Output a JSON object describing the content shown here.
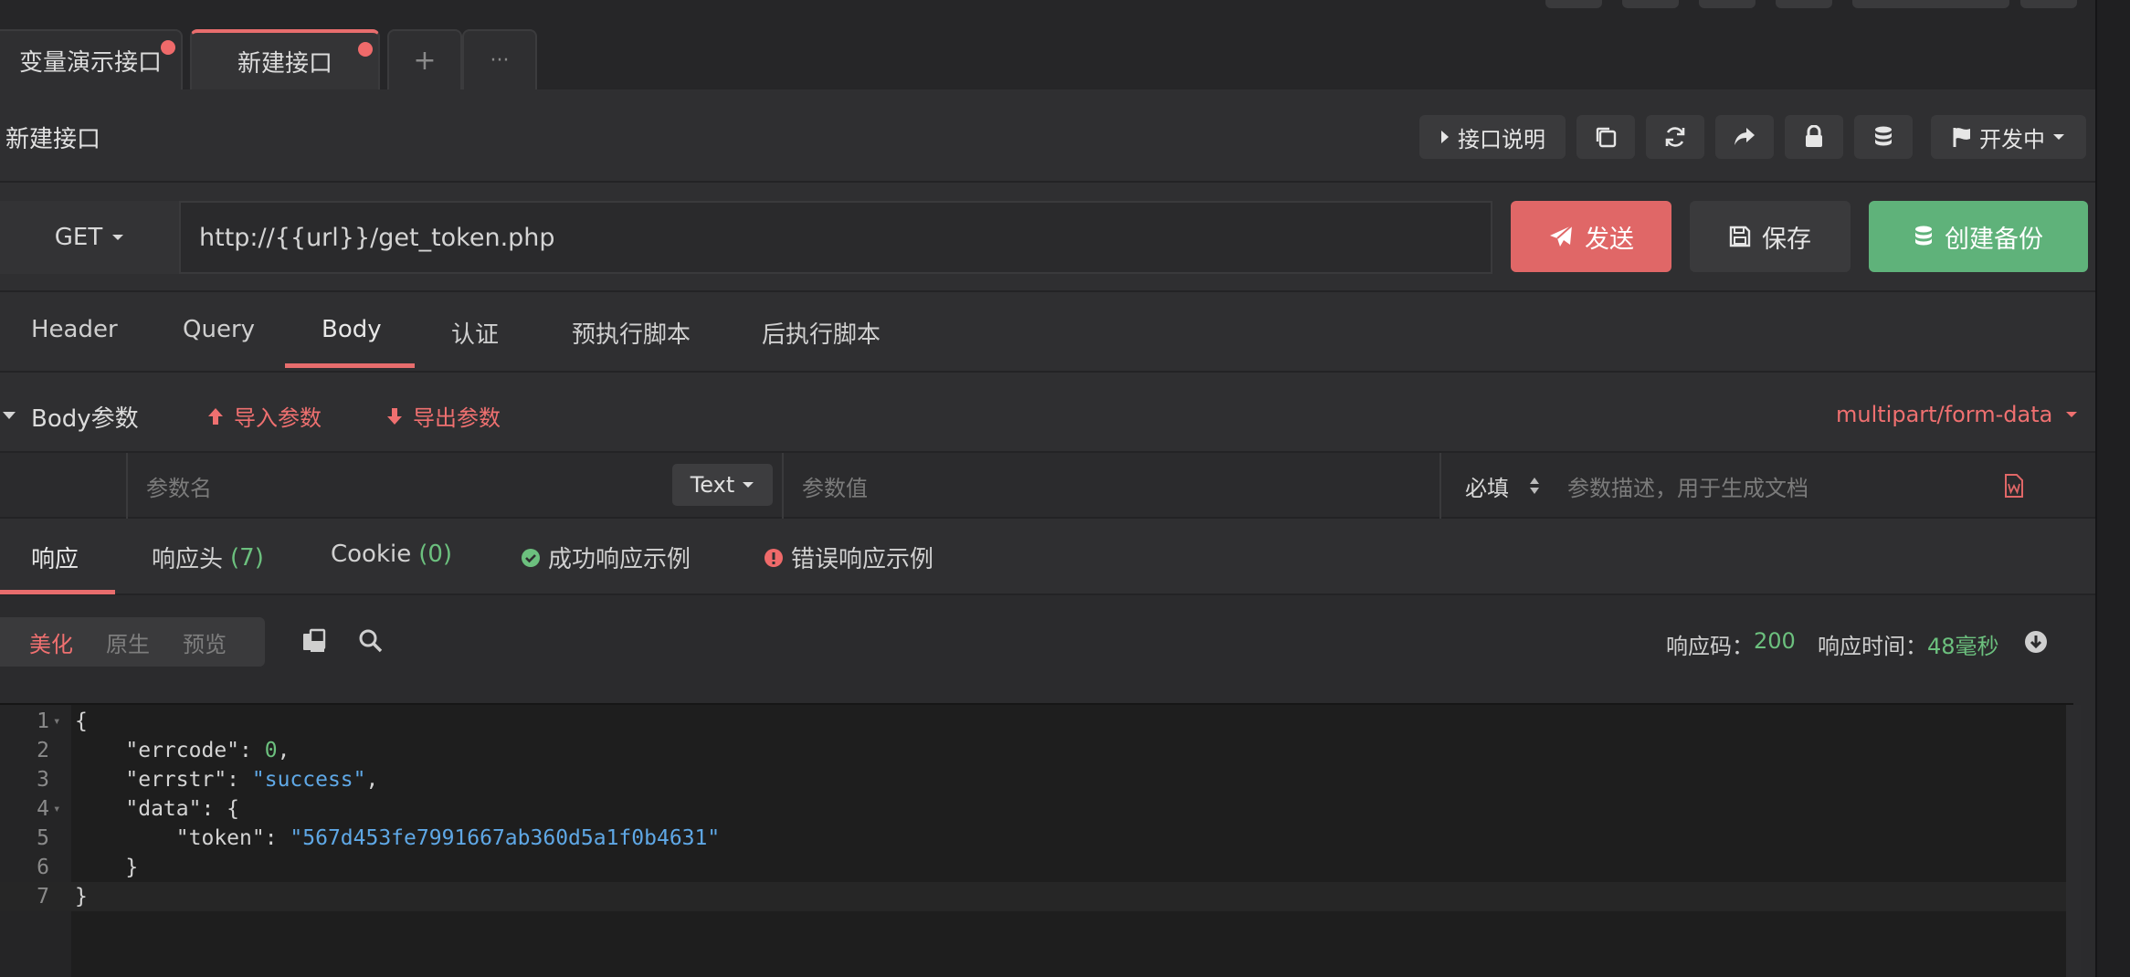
{
  "tabs": [
    {
      "label": "变量演示接口",
      "dirty": true
    },
    {
      "label": "新建接口",
      "dirty": true,
      "active": true
    }
  ],
  "tab_add": "+",
  "tab_more": "···",
  "page_title": "新建接口",
  "toolbar": {
    "doc_label": "接口说明",
    "status_label": "开发中"
  },
  "request": {
    "method": "GET",
    "url": "http://{{url}}/get_token.php",
    "send_label": "发送",
    "save_label": "保存",
    "backup_label": "创建备份"
  },
  "req_tabs": [
    "Header",
    "Query",
    "Body",
    "认证",
    "预执行脚本",
    "后执行脚本"
  ],
  "req_tab_active": "Body",
  "body": {
    "section_label": "Body参数",
    "import_label": "导入参数",
    "export_label": "导出参数",
    "content_type": "multipart/form-data",
    "param_name_placeholder": "参数名",
    "type_label": "Text",
    "param_value_placeholder": "参数值",
    "required_label": "必填",
    "desc_placeholder": "参数描述，用于生成文档"
  },
  "resp_tabs": {
    "response": "响应",
    "headers": "响应头",
    "headers_count": "(7)",
    "cookie": "Cookie",
    "cookie_count": "(0)",
    "success_example": "成功响应示例",
    "error_example": "错误响应示例"
  },
  "view_modes": [
    "美化",
    "原生",
    "预览"
  ],
  "status": {
    "code_label": "响应码：",
    "code_value": "200",
    "time_label": "响应时间：",
    "time_value": "48毫秒"
  },
  "code_lines": [
    {
      "no": "1",
      "p0": "{"
    },
    {
      "no": "2",
      "p0": "    \"errcode\": ",
      "num": "0",
      "p1": ","
    },
    {
      "no": "3",
      "p0": "    \"errstr\": ",
      "str": "\"success\"",
      "p1": ","
    },
    {
      "no": "4",
      "p0": "    \"data\": {"
    },
    {
      "no": "5",
      "p0": "        \"token\": ",
      "str": "\"567d453fe7991667ab360d5a1f0b4631\""
    },
    {
      "no": "6",
      "p0": "    }"
    },
    {
      "no": "7",
      "p0": "}"
    }
  ],
  "colors": {
    "accent": "#e86d6d",
    "send": "#e06767",
    "backup": "#5fb27a",
    "success": "#6cc07e",
    "string": "#5fa8e6"
  }
}
